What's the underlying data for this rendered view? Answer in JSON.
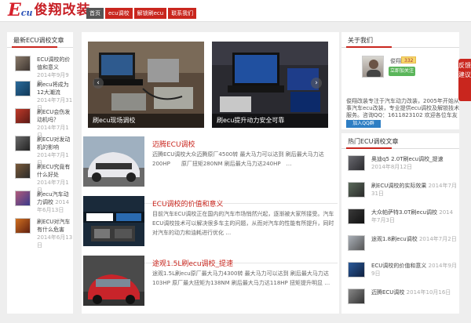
{
  "site": {
    "logo_e": "E",
    "logo_cu": "cu",
    "logo_cn": "俊翔改装"
  },
  "nav": {
    "items": [
      "首页",
      "ecu调校",
      "解锁刷ecu",
      "联系我们"
    ]
  },
  "left_sidebar": {
    "title": "最新ECU调校文章",
    "items": [
      {
        "title": "ECU调校的价值和意义",
        "date": "2014年9月9日"
      },
      {
        "title": "刷ecu将成为12大潮流",
        "date": "2014年7月31日"
      },
      {
        "title": "刷ECU会伤发动机吗？",
        "date": "2014年7月1日"
      },
      {
        "title": "刷ECU对发动机的影响",
        "date": "2014年7月1日"
      },
      {
        "title": "刷ECU究竟有什么好处",
        "date": "2014年7月1日"
      },
      {
        "title": "刷ecu汽车动力调校",
        "date": "2014年6月13日"
      },
      {
        "title": "刷ECU对汽车有什么危害",
        "date": "2014年6月13日"
      }
    ]
  },
  "slider": {
    "slides": [
      {
        "caption": "刷ecu现场调校"
      },
      {
        "caption": "刷ecu提升动力安全可靠"
      }
    ],
    "prev": "‹",
    "next": "›"
  },
  "posts": [
    {
      "title": "迈腾ECU调校",
      "excerpt": "迈腾ECU调校大众迈腾原厂4500转 最大马力可以达到 刷后最大马力达200HP　　原厂扭矩280NM 刷后最大马力达240HP　…"
    },
    {
      "title": "ECU调校的价值和意义",
      "excerpt": "目前汽车ECU调校正在国内的汽车市场悄然兴起，逐渐被大家所接受。汽车ECU调校技术可以解决很多车主的问题，从而对汽车的性能有所提升，同时对汽车的动力和油耗进行优化 …"
    },
    {
      "title": "途观1.5L刷ecu调校_提速",
      "excerpt": "途观1.5L刷ecu原厂最大马力4300转 最大马力可以达到 刷后最大马力达103HP 原厂最大扭矩为138NM 刷后最大马力达118HP 扭矩提升明显 …"
    }
  ],
  "right_profile": {
    "title": "关于我们",
    "user_name": "俊翔",
    "level": "332",
    "follow": "立即加关注",
    "intro": "俊翔改装专注于汽车动力改装，2005年开始从事汽车ecu改装，专业提供ecu调校及解锁技术服务。咨询QQ：1611823102 欢迎各位车友加入！",
    "qq": "加入QQ群"
  },
  "right_list": {
    "title": "热门ECU调校文章",
    "items": [
      {
        "title": "奥迪q5 2.0T刷ecu调校_提速",
        "date": "2014年8月12日"
      },
      {
        "title": "刷ECU调校的实际效果",
        "date": "2014年7月31日"
      },
      {
        "title": "大众帕萨特3.0T刷ecu调校",
        "date": "2014年7月3日"
      },
      {
        "title": "途观1.8刷ecu调校",
        "date": "2014年7月2日"
      },
      {
        "title": "ECU调校的价值和意义",
        "date": "2014年9月9日"
      },
      {
        "title": "迈腾ECU调校",
        "date": "2014年10月16日"
      }
    ]
  },
  "feedback": "反馈建议",
  "colors": {
    "brand_red": "#c9261e",
    "nav_active": "#555555",
    "follow_green": "#5ab55a",
    "qq_blue": "#2d7ec4"
  }
}
